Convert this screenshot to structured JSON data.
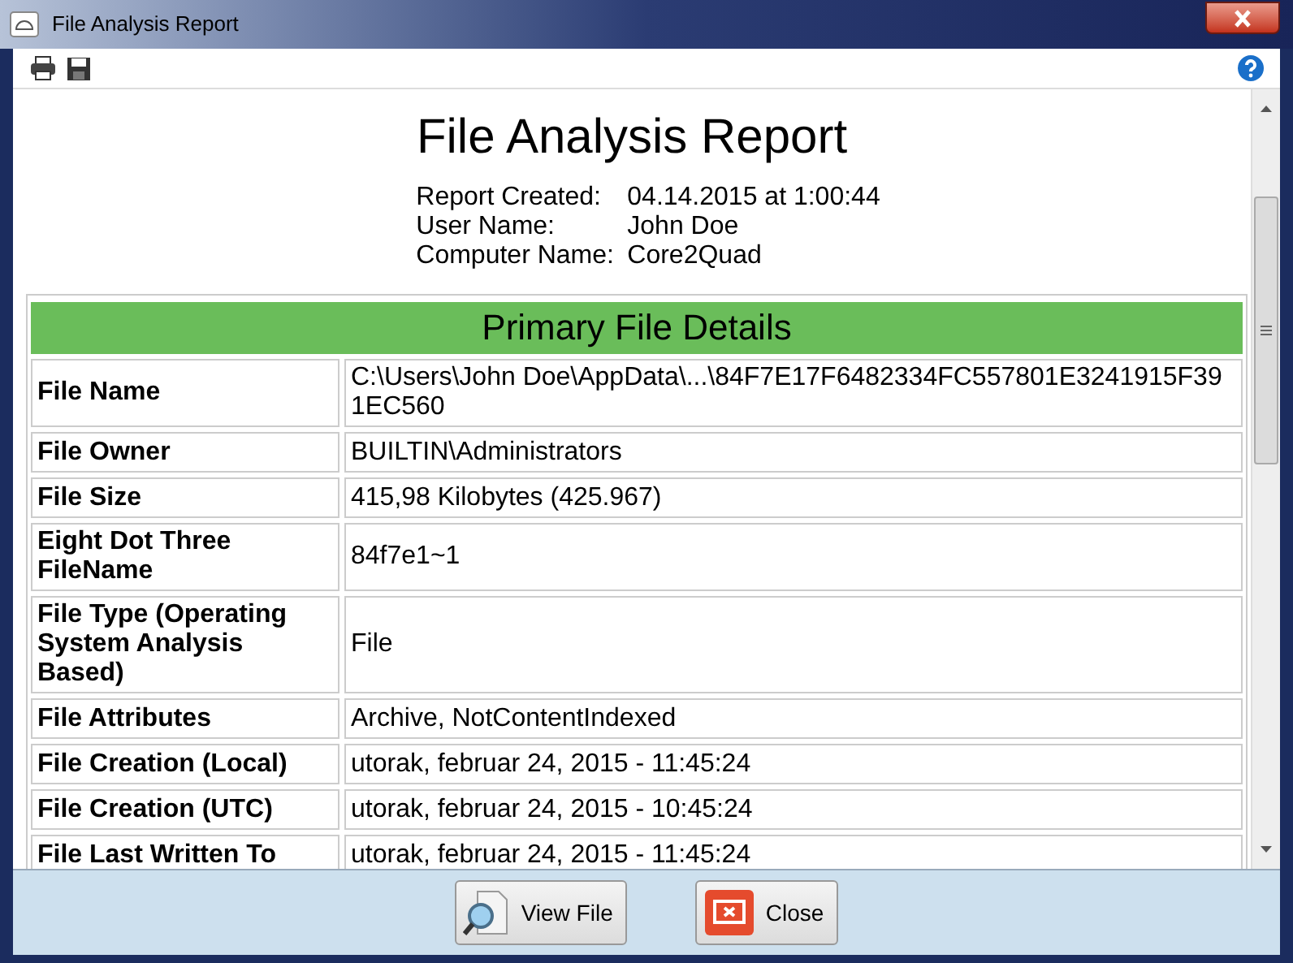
{
  "window": {
    "title": "File Analysis Report"
  },
  "report": {
    "title": "File Analysis Report",
    "meta": [
      {
        "label": "Report Created:",
        "value": "04.14.2015 at 1:00:44"
      },
      {
        "label": "User Name:",
        "value": "John Doe"
      },
      {
        "label": "Computer Name:",
        "value": "Core2Quad"
      }
    ],
    "section": {
      "title": "Primary File Details",
      "rows": [
        {
          "label": "File Name",
          "value": "C:\\Users\\John Doe\\AppData\\...\\84F7E17F6482334FC557801E3241915F391EC560"
        },
        {
          "label": "File Owner",
          "value": "BUILTIN\\Administrators"
        },
        {
          "label": "File Size",
          "value": "415,98 Kilobytes (425.967)"
        },
        {
          "label": "Eight Dot Three FileName",
          "value": "84f7e1~1"
        },
        {
          "label": "File Type (Operating System Analysis Based)",
          "value": "File"
        },
        {
          "label": "File Attributes",
          "value": "Archive, NotContentIndexed"
        },
        {
          "label": "File Creation (Local)",
          "value": "utorak, februar 24, 2015 - 11:45:24"
        },
        {
          "label": "File Creation (UTC)",
          "value": "utorak, februar 24, 2015 - 10:45:24"
        },
        {
          "label": "File Last Written To",
          "value": "utorak, februar 24, 2015 - 11:45:24"
        }
      ]
    }
  },
  "buttons": [
    {
      "kind": "view",
      "label": "View File"
    },
    {
      "kind": "close",
      "label": "Close"
    }
  ]
}
